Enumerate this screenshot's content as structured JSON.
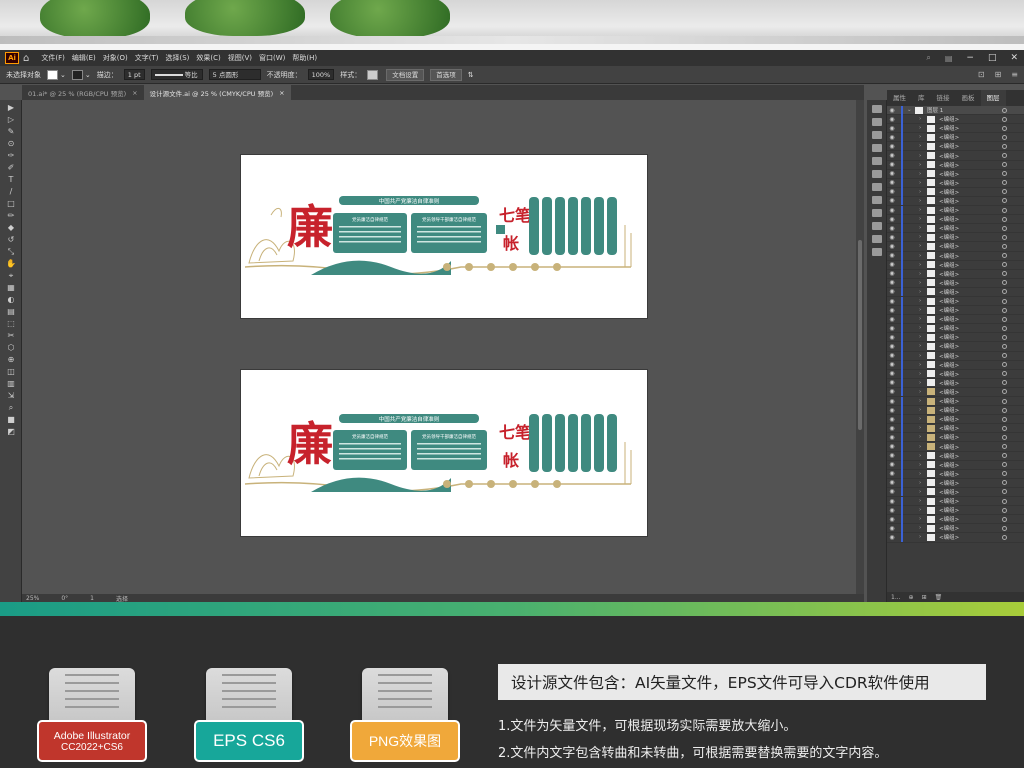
{
  "menu": [
    "文件(F)",
    "编辑(E)",
    "对象(O)",
    "文字(T)",
    "选择(S)",
    "效果(C)",
    "视图(V)",
    "窗口(W)",
    "帮助(H)"
  ],
  "app_badge": "Ai",
  "window_controls": {
    "minimize": "−",
    "restore": "□",
    "close": "✕"
  },
  "control_bar": {
    "selection": "未选择对象",
    "stroke_label": "描边：",
    "stroke_value": "1 pt",
    "profile": "等比",
    "brush": "5 点圆形",
    "opacity_label": "不透明度：",
    "opacity_value": "100%",
    "style_label": "样式：",
    "doc_setup": "文档设置",
    "prefs": "首选项"
  },
  "tabs": [
    {
      "label": "01.ai* @ 25 % (RGB/CPU 预览)",
      "close": "×",
      "active": false
    },
    {
      "label": "设计源文件.ai @ 25 % (CMYK/CPU 预览)",
      "close": "×",
      "active": true
    }
  ],
  "status": {
    "zoom": "25%",
    "angle": "0°",
    "artboard": "1",
    "tool": "选择"
  },
  "panel_tabs": [
    "属性",
    "库",
    "链接",
    "画板",
    "图层"
  ],
  "layers": {
    "top": "图层 1",
    "item": "<编组>",
    "items_count": 47,
    "footer_count": "1..."
  },
  "artwork": {
    "title_char": "廉",
    "banner": "中国共产党廉洁自律准则",
    "box1_title": "党员廉洁自律规范",
    "box2_title": "党员领导干部廉洁自律规范",
    "seven": "七笔",
    "account": "帐",
    "colors": {
      "teal": "#3f8a80",
      "red": "#c7222c",
      "tan": "#c8b27a"
    }
  },
  "bottom": {
    "files": [
      {
        "line1": "Adobe Illustrator",
        "line2": "CC2022+CS6",
        "color": "#c0362c"
      },
      {
        "line1": "EPS CS6",
        "line2": "",
        "color": "#17a79a"
      },
      {
        "line1": "PNG效果图",
        "line2": "",
        "color": "#f0a83a"
      }
    ],
    "info_title": "设计源文件包含：AI矢量文件，EPS文件可导入CDR软件使用",
    "note1": "1.文件为矢量文件，可根据现场实际需要放大缩小。",
    "note2": "2.文件内文字包含转曲和未转曲，可根据需要替换需要的文字内容。"
  }
}
